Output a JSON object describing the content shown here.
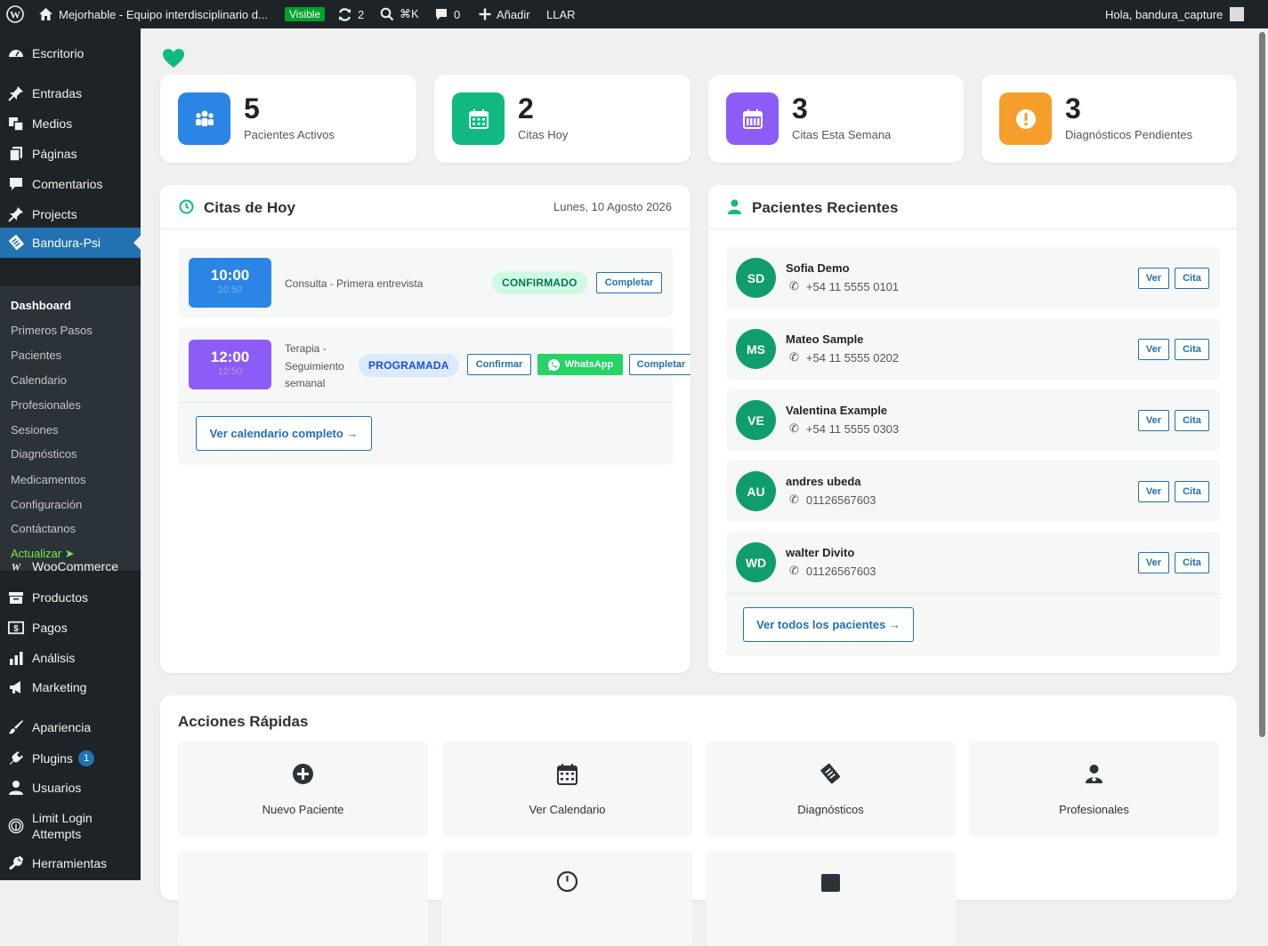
{
  "admin_bar": {
    "site_name": "Mejorhable - Equipo interdisciplinario d...",
    "visibility": "Visible",
    "updates_count": "2",
    "search_shortcut": "⌘K",
    "comments_count": "0",
    "add_new": "Añadir",
    "plugin_label": "LLAR",
    "greeting": "Hola, bandura_capture"
  },
  "sidebar": {
    "items": [
      {
        "label": "Escritorio",
        "icon": "dashboard-icon"
      },
      {
        "label": "Entradas",
        "icon": "pin-icon"
      },
      {
        "label": "Medios",
        "icon": "media-icon"
      },
      {
        "label": "Páginas",
        "icon": "pages-icon"
      },
      {
        "label": "Comentarios",
        "icon": "comment-icon"
      },
      {
        "label": "Projects",
        "icon": "pin-icon"
      },
      {
        "label": "Bandura-Psi",
        "icon": "clipboard-icon"
      },
      {
        "label": "WooCommerce",
        "icon": "woo-icon"
      },
      {
        "label": "Productos",
        "icon": "archive-icon"
      },
      {
        "label": "Pagos",
        "icon": "money-icon"
      },
      {
        "label": "Análisis",
        "icon": "chart-icon"
      },
      {
        "label": "Marketing",
        "icon": "megaphone-icon"
      },
      {
        "label": "Apariencia",
        "icon": "brush-icon"
      },
      {
        "label": "Plugins",
        "icon": "plugin-icon",
        "badge": "1"
      },
      {
        "label": "Usuarios",
        "icon": "user-icon"
      },
      {
        "label": "Limit Login Attempts",
        "icon": "fingerprint-icon"
      },
      {
        "label": "Herramientas",
        "icon": "wrench-icon"
      }
    ],
    "submenu": [
      "Dashboard",
      "Primeros Pasos",
      "Pacientes",
      "Calendario",
      "Profesionales",
      "Sesiones",
      "Diagnósticos",
      "Medicamentos",
      "Configuración",
      "Contáctanos"
    ],
    "update_label": "Actualizar ➤"
  },
  "stats": [
    {
      "value": "5",
      "label": "Pacientes Activos",
      "color": "#2b85e4",
      "icon": "users-icon"
    },
    {
      "value": "2",
      "label": "Citas Hoy",
      "color": "#10b981",
      "icon": "calendar-icon"
    },
    {
      "value": "3",
      "label": "Citas Esta Semana",
      "color": "#8b5cf6",
      "icon": "calendar-week-icon"
    },
    {
      "value": "3",
      "label": "Diagnósticos Pendientes",
      "color": "#f59e2b",
      "icon": "warning-icon"
    }
  ],
  "citas": {
    "title": "Citas de Hoy",
    "date": "Lunes, 10 Agosto 2026",
    "items": [
      {
        "time": "10:00",
        "end": "10:50",
        "desc": "Consulta - Primera entrevista",
        "status": "CONFIRMADO",
        "actions": [
          "Completar"
        ]
      },
      {
        "time": "12:00",
        "end": "12:50",
        "desc_lines": [
          "Terapia -",
          "Seguimiento",
          "semanal"
        ],
        "status": "PROGRAMADA",
        "actions": [
          "Confirmar",
          "WhatsApp",
          "Completar"
        ]
      }
    ],
    "calendar_link": "Ver calendario completo →"
  },
  "pacientes": {
    "title": "Pacientes Recientes",
    "items": [
      {
        "initials": "SD",
        "name": "Sofia Demo",
        "phone": "+54 11 5555 0101"
      },
      {
        "initials": "MS",
        "name": "Mateo Sample",
        "phone": "+54 11 5555 0202"
      },
      {
        "initials": "VE",
        "name": "Valentina Example",
        "phone": "+54 11 5555 0303"
      },
      {
        "initials": "AU",
        "name": "andres ubeda",
        "phone": "01126567603"
      },
      {
        "initials": "WD",
        "name": "walter Divito",
        "phone": "01126567603"
      }
    ],
    "ver_label": "Ver",
    "cita_label": "Cita",
    "all_link": "Ver todos los pacientes →"
  },
  "quick_actions": {
    "title": "Acciones Rápidas",
    "items": [
      {
        "label": "Nuevo Paciente",
        "icon": "plus-circle-icon"
      },
      {
        "label": "Ver Calendario",
        "icon": "calendar-icon"
      },
      {
        "label": "Diagnósticos",
        "icon": "clipboard-icon"
      },
      {
        "label": "Profesionales",
        "icon": "doctor-icon"
      }
    ]
  }
}
